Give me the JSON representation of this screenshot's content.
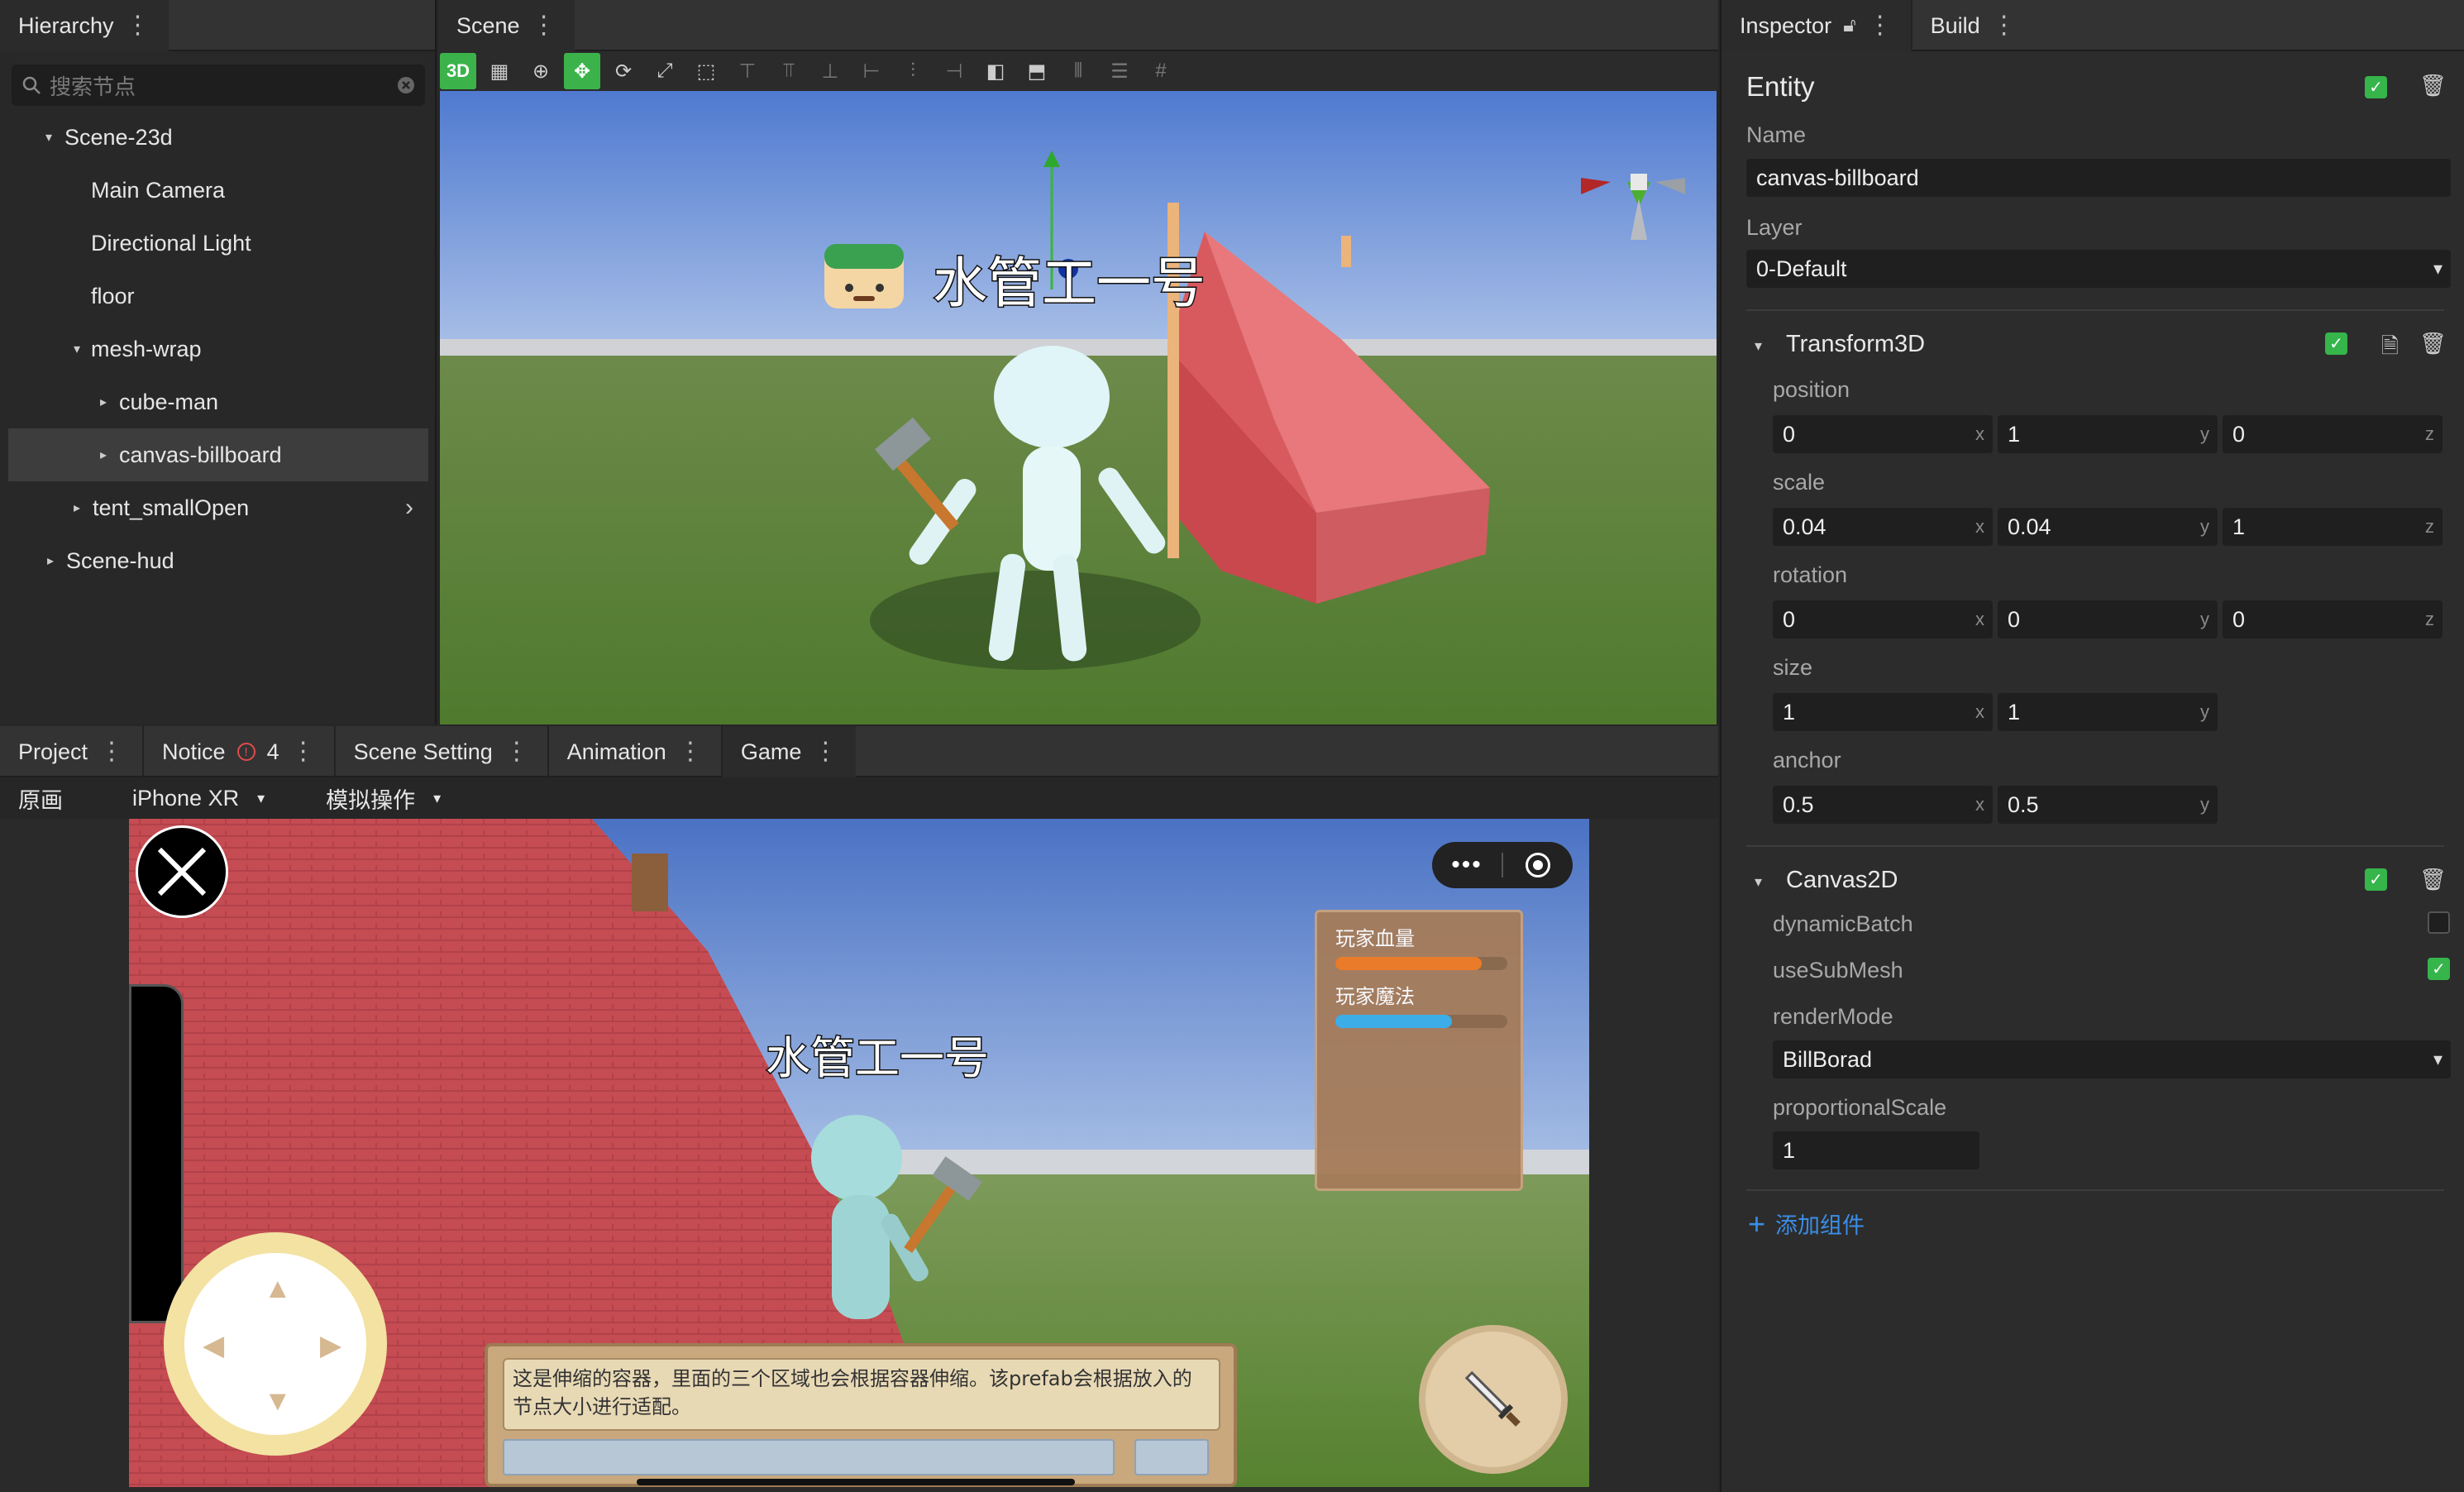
{
  "hierarchy": {
    "tab": "Hierarchy",
    "search_placeholder": "搜索节点",
    "nodes": [
      {
        "label": "Scene-23d"
      },
      {
        "label": "Main Camera"
      },
      {
        "label": "Directional Light"
      },
      {
        "label": "floor"
      },
      {
        "label": "mesh-wrap"
      },
      {
        "label": "cube-man"
      },
      {
        "label": "canvas-billboard"
      },
      {
        "label": "tent_smallOpen"
      },
      {
        "label": "Scene-hud"
      }
    ]
  },
  "scene": {
    "tab": "Scene",
    "mode_button": "3D",
    "billboard_text": "水管工一号"
  },
  "bottom": {
    "tabs": [
      {
        "label": "Project"
      },
      {
        "label": "Notice",
        "badge": "4"
      },
      {
        "label": "Scene Setting"
      },
      {
        "label": "Animation"
      },
      {
        "label": "Game"
      }
    ],
    "sub": {
      "original": "原画",
      "device": "iPhone XR",
      "simulate": "模拟操作"
    },
    "game": {
      "billboard_text": "水管工一号",
      "hp_label": "玩家血量",
      "mp_label": "玩家魔法",
      "hp_value": 0.85,
      "mp_value": 0.68,
      "dialog_text": "这是伸缩的容器，里面的三个区域也会根据容器伸缩。该prefab会根据放入的节点大小进行适配。",
      "hp_color": "#f07a22",
      "mp_color": "#3aaee8"
    }
  },
  "inspector": {
    "tab": "Inspector",
    "build_tab": "Build",
    "entity_title": "Entity",
    "name_label": "Name",
    "name_value": "canvas-billboard",
    "layer_label": "Layer",
    "layer_value": "0-Default",
    "transform": {
      "title": "Transform3D",
      "position_label": "position",
      "position": {
        "x": "0",
        "y": "1",
        "z": "0"
      },
      "scale_label": "scale",
      "scale": {
        "x": "0.04",
        "y": "0.04",
        "z": "1"
      },
      "rotation_label": "rotation",
      "rotation": {
        "x": "0",
        "y": "0",
        "z": "0"
      },
      "size_label": "size",
      "size": {
        "x": "1",
        "y": "1"
      },
      "anchor_label": "anchor",
      "anchor": {
        "x": "0.5",
        "y": "0.5"
      },
      "axis_x": "x",
      "axis_y": "y",
      "axis_z": "z"
    },
    "canvas2d": {
      "title": "Canvas2D",
      "dynamic_batch_label": "dynamicBatch",
      "dynamic_batch": false,
      "use_sub_mesh_label": "useSubMesh",
      "use_sub_mesh": true,
      "render_mode_label": "renderMode",
      "render_mode": "BillBorad",
      "proportional_scale_label": "proportionalScale",
      "proportional_scale": "1"
    },
    "add_component": "添加组件",
    "accent": "#3bb34a",
    "link_color": "#3a8ee6"
  }
}
